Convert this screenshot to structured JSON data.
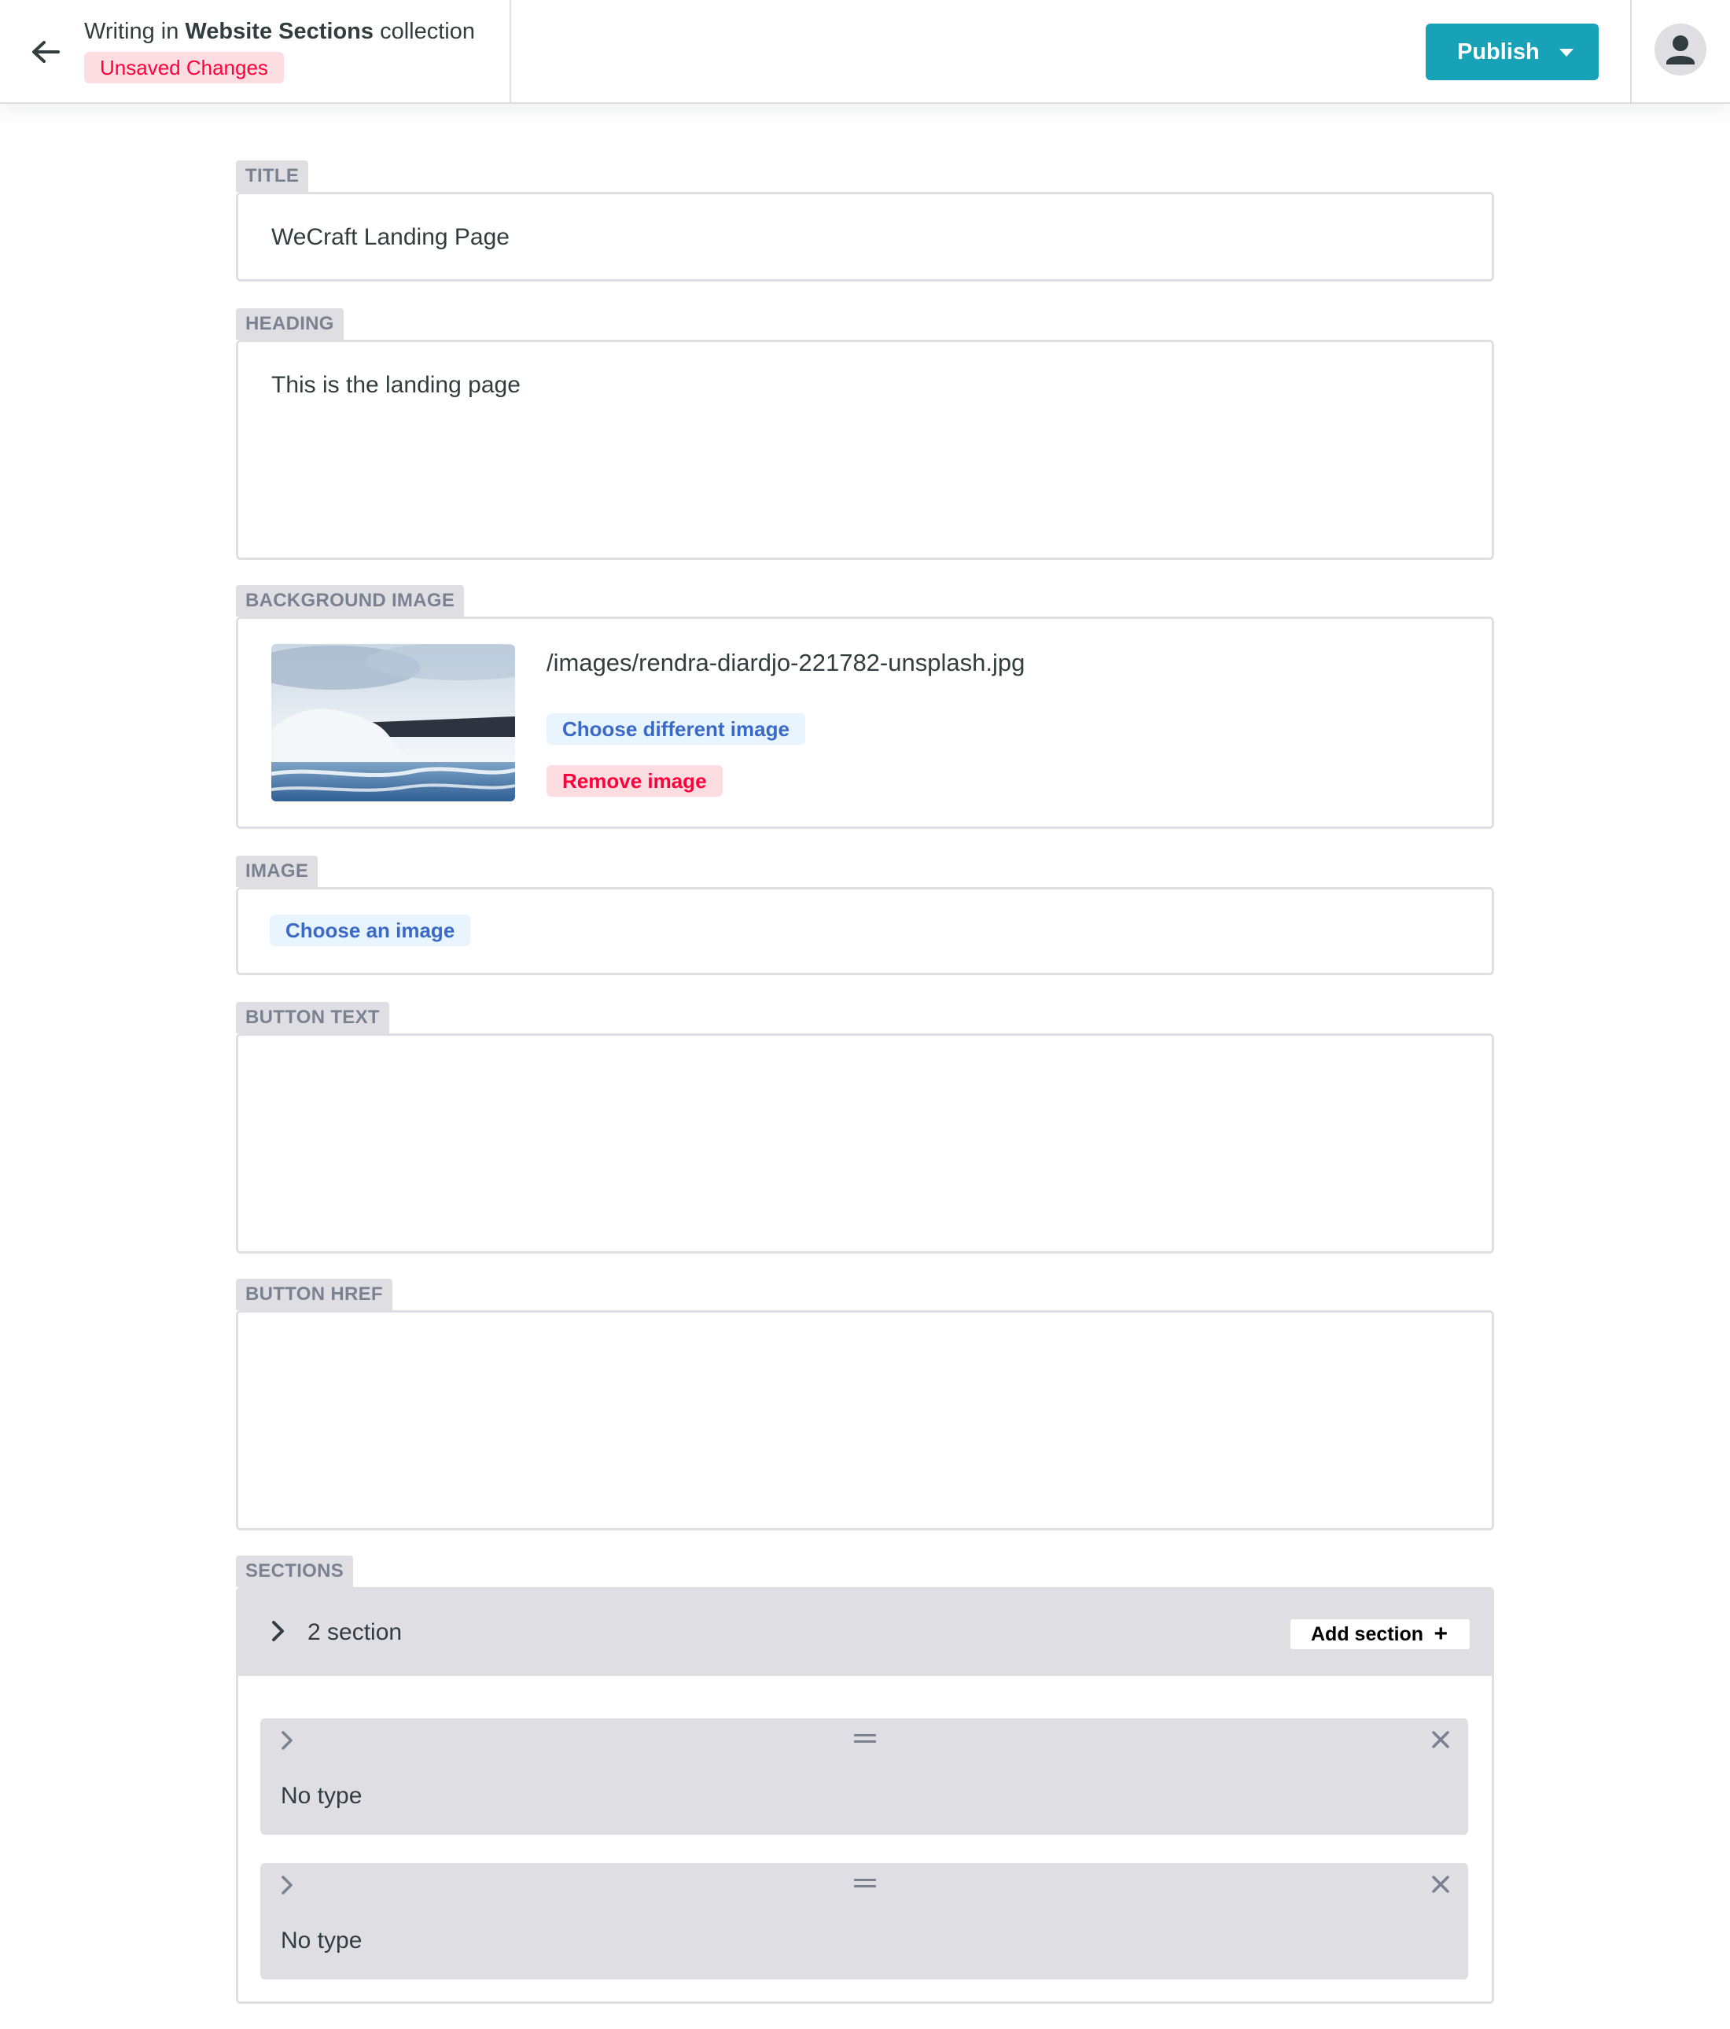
{
  "header": {
    "writing_prefix": "Writing in",
    "collection_name": "Website Sections",
    "writing_suffix": "collection",
    "unsaved_badge": "Unsaved Changes",
    "publish_label": "Publish"
  },
  "fields": {
    "title": {
      "label": "TITLE",
      "value": "WeCraft Landing Page"
    },
    "heading": {
      "label": "HEADING",
      "value": "This is the landing page"
    },
    "background_image": {
      "label": "BACKGROUND IMAGE",
      "path": "/images/rendra-diardjo-221782-unsplash.jpg",
      "choose_different_label": "Choose different image",
      "remove_label": "Remove image"
    },
    "image": {
      "label": "IMAGE",
      "choose_label": "Choose an image"
    },
    "button_text": {
      "label": "BUTTON TEXT",
      "value": ""
    },
    "button_href": {
      "label": "BUTTON HREF",
      "value": ""
    },
    "sections": {
      "label": "SECTIONS",
      "count_label": "2 section",
      "add_label": "Add section",
      "items": [
        {
          "type_label": "No type"
        },
        {
          "type_label": "No type"
        }
      ]
    }
  },
  "icons": {
    "back": "arrow-left-icon",
    "publish_caret": "caret-down-icon",
    "avatar": "user-icon",
    "expand": "chevron-right-icon",
    "drag": "drag-handle-icon",
    "remove": "close-icon",
    "add": "plus-icon"
  },
  "colors": {
    "primary": "#17a2b8",
    "label_bg": "#dfdfe3",
    "label_text": "#7a8291",
    "danger": "#ff003b",
    "danger_bg": "#fcdde1",
    "link_blue": "#3a69c7",
    "link_bg": "#e8f5fe",
    "text": "#313d3e"
  }
}
